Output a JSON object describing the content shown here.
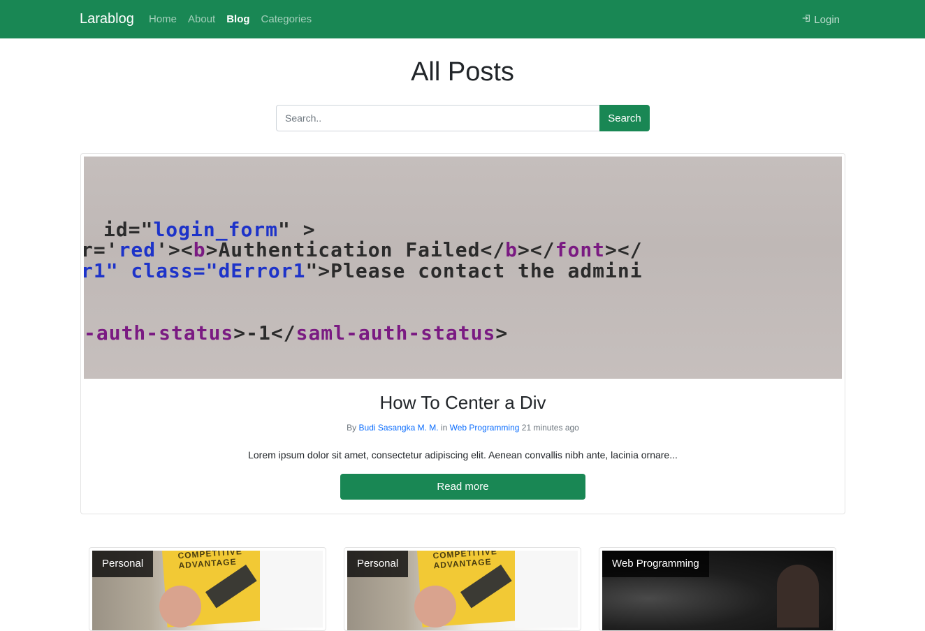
{
  "nav": {
    "brand": "Larablog",
    "links": [
      {
        "label": "Home"
      },
      {
        "label": "About"
      },
      {
        "label": "Blog"
      },
      {
        "label": "Categories"
      }
    ],
    "login_label": "Login",
    "color": "#198754"
  },
  "page_title": "All Posts",
  "search": {
    "placeholder": "Search..",
    "button_label": "Search"
  },
  "featured": {
    "image_code": {
      "line1_pre": "id=\"",
      "line1_val": "login_form",
      "line1_post": "\" >",
      "line2_pre": "r='",
      "line2_val": "red",
      "line2_mid": "'><",
      "line2_b": "b",
      "line2_text": ">Authentication Failed</",
      "line2_b2": "b",
      "line2_mid2": "></",
      "line2_font": "font",
      "line2_end": "></",
      "line3_pre": "r1\" class=\"",
      "line3_val": "dError1",
      "line3_text": "\">Please contact the admini",
      "line4_tag": "-auth-status",
      "line4_text": ">-1</",
      "line4_tag2": "saml-auth-status",
      "line4_end": ">"
    },
    "title": "How To Center a Div",
    "meta_by": "By",
    "author": "Budi Sasangka M. M.",
    "meta_in": "in",
    "category": "Web Programming",
    "time": "21 minutes ago",
    "excerpt": "Lorem ipsum dolor sit amet, consectetur adipiscing elit. Aenean convallis nibh ante, lacinia ornare...",
    "button_label": "Read more"
  },
  "cards": [
    {
      "category": "Personal",
      "book_title": "COMPETITIVE ADVANTAGE"
    },
    {
      "category": "Personal",
      "book_title": "COMPETITIVE ADVANTAGE"
    },
    {
      "category": "Web Programming"
    }
  ]
}
